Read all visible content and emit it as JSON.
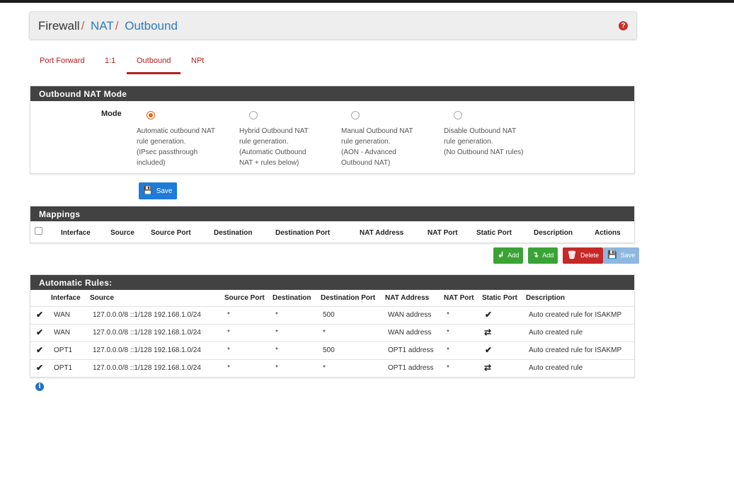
{
  "breadcrumb": {
    "root": "Firewall",
    "sep1": "/",
    "level2": "NAT",
    "sep2": "/",
    "current": "Outbound"
  },
  "help_icon": {
    "glyph": "?"
  },
  "tabs": [
    {
      "label": "Port Forward",
      "active": false
    },
    {
      "label": "1:1",
      "active": false
    },
    {
      "label": "Outbound",
      "active": true
    },
    {
      "label": "NPt",
      "active": false
    }
  ],
  "mode_panel": {
    "title": "Outbound NAT Mode",
    "mode_label": "Mode",
    "options": [
      {
        "lines": [
          "Automatic outbound NAT",
          "rule generation.",
          "(IPsec passthrough",
          "included)"
        ],
        "checked": true
      },
      {
        "lines": [
          "Hybrid Outbound NAT",
          "rule generation.",
          "(Automatic Outbound",
          "NAT + rules below)"
        ],
        "checked": false
      },
      {
        "lines": [
          "Manual Outbound NAT",
          "rule generation.",
          "(AON - Advanced",
          "Outbound NAT)"
        ],
        "checked": false
      },
      {
        "lines": [
          "Disable Outbound NAT",
          "rule generation.",
          "(No Outbound NAT rules)"
        ],
        "checked": false
      }
    ],
    "save_label": "Save"
  },
  "mappings": {
    "title": "Mappings",
    "columns": [
      "Interface",
      "Source",
      "Source Port",
      "Destination",
      "Destination Port",
      "NAT Address",
      "NAT Port",
      "Static Port",
      "Description",
      "Actions"
    ],
    "buttons": {
      "add_top": "Add",
      "add_bottom": "Add",
      "delete": "Delete",
      "save": "Save"
    }
  },
  "auto_rules": {
    "title": "Automatic Rules:",
    "columns": [
      "Interface",
      "Source",
      "Source Port",
      "Destination",
      "Destination Port",
      "NAT Address",
      "NAT Port",
      "Static Port",
      "Description"
    ],
    "rows": [
      {
        "interface": "WAN",
        "source": "127.0.0.0/8 ::1/128 192.168.1.0/24",
        "source_port": "*",
        "destination": "*",
        "destination_port": "500",
        "nat_address": "WAN address",
        "nat_port": "*",
        "static_port": "check-icon",
        "description": "Auto created rule for ISAKMP"
      },
      {
        "interface": "WAN",
        "source": "127.0.0.0/8 ::1/128 192.168.1.0/24",
        "source_port": "*",
        "destination": "*",
        "destination_port": "*",
        "nat_address": "WAN address",
        "nat_port": "*",
        "static_port": "shuffle-icon",
        "description": "Auto created rule"
      },
      {
        "interface": "OPT1",
        "source": "127.0.0.0/8 ::1/128 192.168.1.0/24",
        "source_port": "*",
        "destination": "*",
        "destination_port": "500",
        "nat_address": "OPT1 address",
        "nat_port": "*",
        "static_port": "check-icon",
        "description": "Auto created rule for ISAKMP"
      },
      {
        "interface": "OPT1",
        "source": "127.0.0.0/8 ::1/128 192.168.1.0/24",
        "source_port": "*",
        "destination": "*",
        "destination_port": "*",
        "nat_address": "OPT1 address",
        "nat_port": "*",
        "static_port": "shuffle-icon",
        "description": "Auto created rule"
      }
    ]
  },
  "info_icon": {
    "glyph": "i"
  },
  "colors": {
    "accent": "#b71c1c",
    "panel_header": "#424242",
    "primary": "#1e7bd6",
    "success": "#3aa335",
    "danger": "#c62828",
    "radio_checked": "#e8650f"
  }
}
